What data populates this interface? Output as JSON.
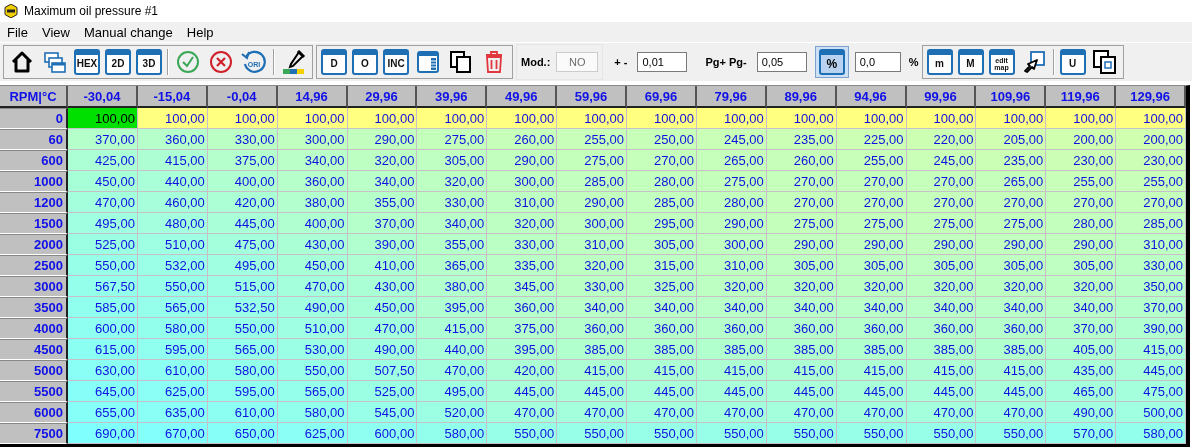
{
  "window": {
    "title": "Maximum oil pressure #1"
  },
  "menu": [
    {
      "label": "File"
    },
    {
      "label": "View"
    },
    {
      "label": "Manual change"
    },
    {
      "label": "Help"
    }
  ],
  "toolbar": {
    "groups": [
      [
        {
          "kind": "home"
        },
        {
          "kind": "windows"
        },
        {
          "kind": "tile",
          "label": "HEX"
        },
        {
          "kind": "tile",
          "label": "2D"
        },
        {
          "kind": "tile",
          "label": "3D"
        },
        {
          "kind": "sep"
        },
        {
          "kind": "accept"
        },
        {
          "kind": "cancel"
        },
        {
          "kind": "revert",
          "label": "ORI"
        },
        {
          "kind": "sep"
        },
        {
          "kind": "picker"
        }
      ],
      [
        {
          "kind": "tile",
          "label": "D"
        },
        {
          "kind": "tile",
          "label": "O"
        },
        {
          "kind": "tile",
          "label": "INC"
        },
        {
          "kind": "panel"
        },
        {
          "kind": "copy"
        },
        {
          "kind": "trash"
        }
      ]
    ],
    "mod": {
      "label": "Mod.:",
      "value": "NO",
      "disabled": true
    },
    "step": {
      "label": "+ -",
      "value": "0,01"
    },
    "page_step": {
      "label": "Pg+ Pg-",
      "value": "0,05"
    },
    "percent": {
      "label": "%",
      "on": true,
      "value": "0,0",
      "unit": "%"
    },
    "groups_right": [
      [
        {
          "kind": "tile",
          "label": "m"
        },
        {
          "kind": "tile",
          "label": "M"
        },
        {
          "kind": "small_tile",
          "label": "edit map"
        },
        {
          "kind": "cursor"
        },
        {
          "kind": "sep"
        },
        {
          "kind": "tile",
          "label": "U"
        },
        {
          "kind": "frames"
        }
      ]
    ]
  },
  "table": {
    "corner": "RPM|°C",
    "columns": [
      "-30,04",
      "-15,04",
      "-0,04",
      "14,96",
      "29,96",
      "39,96",
      "49,96",
      "59,96",
      "69,96",
      "79,96",
      "89,96",
      "94,96",
      "99,96",
      "109,96",
      "119,96",
      "129,96"
    ],
    "rows": [
      {
        "label": "0",
        "cells": [
          {
            "value": "100,00",
            "selected": true
          },
          {
            "value": "100,00",
            "selected": false
          },
          {
            "value": "100,00",
            "selected": false
          },
          {
            "value": "100,00",
            "selected": false
          },
          {
            "value": "100,00",
            "selected": false
          },
          {
            "value": "100,00",
            "selected": false
          },
          {
            "value": "100,00",
            "selected": false
          },
          {
            "value": "100,00",
            "selected": false
          },
          {
            "value": "100,00",
            "selected": false
          },
          {
            "value": "100,00",
            "selected": false
          },
          {
            "value": "100,00",
            "selected": false
          },
          {
            "value": "100,00",
            "selected": false
          },
          {
            "value": "100,00",
            "selected": false
          },
          {
            "value": "100,00",
            "selected": false
          },
          {
            "value": "100,00",
            "selected": false
          },
          {
            "value": "100,00",
            "selected": false
          }
        ]
      },
      {
        "label": "60",
        "cells": [
          {
            "value": "370,00",
            "selected": false
          },
          {
            "value": "360,00",
            "selected": false
          },
          {
            "value": "330,00",
            "selected": false
          },
          {
            "value": "300,00",
            "selected": false
          },
          {
            "value": "290,00",
            "selected": false
          },
          {
            "value": "275,00",
            "selected": false
          },
          {
            "value": "260,00",
            "selected": false
          },
          {
            "value": "255,00",
            "selected": false
          },
          {
            "value": "250,00",
            "selected": false
          },
          {
            "value": "245,00",
            "selected": false
          },
          {
            "value": "235,00",
            "selected": false
          },
          {
            "value": "225,00",
            "selected": false
          },
          {
            "value": "220,00",
            "selected": false
          },
          {
            "value": "205,00",
            "selected": false
          },
          {
            "value": "200,00",
            "selected": false
          },
          {
            "value": "200,00",
            "selected": false
          }
        ]
      },
      {
        "label": "600",
        "cells": [
          {
            "value": "425,00",
            "selected": false
          },
          {
            "value": "415,00",
            "selected": false
          },
          {
            "value": "375,00",
            "selected": false
          },
          {
            "value": "340,00",
            "selected": false
          },
          {
            "value": "320,00",
            "selected": false
          },
          {
            "value": "305,00",
            "selected": false
          },
          {
            "value": "290,00",
            "selected": false
          },
          {
            "value": "275,00",
            "selected": false
          },
          {
            "value": "270,00",
            "selected": false
          },
          {
            "value": "265,00",
            "selected": false
          },
          {
            "value": "260,00",
            "selected": false
          },
          {
            "value": "255,00",
            "selected": false
          },
          {
            "value": "245,00",
            "selected": false
          },
          {
            "value": "235,00",
            "selected": false
          },
          {
            "value": "230,00",
            "selected": false
          },
          {
            "value": "230,00",
            "selected": false
          }
        ]
      },
      {
        "label": "1000",
        "cells": [
          {
            "value": "450,00",
            "selected": false
          },
          {
            "value": "440,00",
            "selected": false
          },
          {
            "value": "400,00",
            "selected": false
          },
          {
            "value": "360,00",
            "selected": false
          },
          {
            "value": "340,00",
            "selected": false
          },
          {
            "value": "320,00",
            "selected": false
          },
          {
            "value": "300,00",
            "selected": false
          },
          {
            "value": "285,00",
            "selected": false
          },
          {
            "value": "280,00",
            "selected": false
          },
          {
            "value": "275,00",
            "selected": false
          },
          {
            "value": "270,00",
            "selected": false
          },
          {
            "value": "270,00",
            "selected": false
          },
          {
            "value": "270,00",
            "selected": false
          },
          {
            "value": "265,00",
            "selected": false
          },
          {
            "value": "255,00",
            "selected": false
          },
          {
            "value": "255,00",
            "selected": false
          }
        ]
      },
      {
        "label": "1200",
        "cells": [
          {
            "value": "470,00",
            "selected": false
          },
          {
            "value": "460,00",
            "selected": false
          },
          {
            "value": "420,00",
            "selected": false
          },
          {
            "value": "380,00",
            "selected": false
          },
          {
            "value": "355,00",
            "selected": false
          },
          {
            "value": "330,00",
            "selected": false
          },
          {
            "value": "310,00",
            "selected": false
          },
          {
            "value": "290,00",
            "selected": false
          },
          {
            "value": "285,00",
            "selected": false
          },
          {
            "value": "280,00",
            "selected": false
          },
          {
            "value": "270,00",
            "selected": false
          },
          {
            "value": "270,00",
            "selected": false
          },
          {
            "value": "270,00",
            "selected": false
          },
          {
            "value": "270,00",
            "selected": false
          },
          {
            "value": "270,00",
            "selected": false
          },
          {
            "value": "270,00",
            "selected": false
          }
        ]
      },
      {
        "label": "1500",
        "cells": [
          {
            "value": "495,00",
            "selected": false
          },
          {
            "value": "480,00",
            "selected": false
          },
          {
            "value": "445,00",
            "selected": false
          },
          {
            "value": "400,00",
            "selected": false
          },
          {
            "value": "370,00",
            "selected": false
          },
          {
            "value": "340,00",
            "selected": false
          },
          {
            "value": "320,00",
            "selected": false
          },
          {
            "value": "300,00",
            "selected": false
          },
          {
            "value": "295,00",
            "selected": false
          },
          {
            "value": "290,00",
            "selected": false
          },
          {
            "value": "275,00",
            "selected": false
          },
          {
            "value": "275,00",
            "selected": false
          },
          {
            "value": "275,00",
            "selected": false
          },
          {
            "value": "275,00",
            "selected": false
          },
          {
            "value": "280,00",
            "selected": false
          },
          {
            "value": "285,00",
            "selected": false
          }
        ]
      },
      {
        "label": "2000",
        "cells": [
          {
            "value": "525,00",
            "selected": false
          },
          {
            "value": "510,00",
            "selected": false
          },
          {
            "value": "475,00",
            "selected": false
          },
          {
            "value": "430,00",
            "selected": false
          },
          {
            "value": "390,00",
            "selected": false
          },
          {
            "value": "355,00",
            "selected": false
          },
          {
            "value": "330,00",
            "selected": false
          },
          {
            "value": "310,00",
            "selected": false
          },
          {
            "value": "305,00",
            "selected": false
          },
          {
            "value": "300,00",
            "selected": false
          },
          {
            "value": "290,00",
            "selected": false
          },
          {
            "value": "290,00",
            "selected": false
          },
          {
            "value": "290,00",
            "selected": false
          },
          {
            "value": "290,00",
            "selected": false
          },
          {
            "value": "290,00",
            "selected": false
          },
          {
            "value": "310,00",
            "selected": false
          }
        ]
      },
      {
        "label": "2500",
        "cells": [
          {
            "value": "550,00",
            "selected": false
          },
          {
            "value": "532,00",
            "selected": false
          },
          {
            "value": "495,00",
            "selected": false
          },
          {
            "value": "450,00",
            "selected": false
          },
          {
            "value": "410,00",
            "selected": false
          },
          {
            "value": "365,00",
            "selected": false
          },
          {
            "value": "335,00",
            "selected": false
          },
          {
            "value": "320,00",
            "selected": false
          },
          {
            "value": "315,00",
            "selected": false
          },
          {
            "value": "310,00",
            "selected": false
          },
          {
            "value": "305,00",
            "selected": false
          },
          {
            "value": "305,00",
            "selected": false
          },
          {
            "value": "305,00",
            "selected": false
          },
          {
            "value": "305,00",
            "selected": false
          },
          {
            "value": "305,00",
            "selected": false
          },
          {
            "value": "330,00",
            "selected": false
          }
        ]
      },
      {
        "label": "3000",
        "cells": [
          {
            "value": "567,50",
            "selected": false
          },
          {
            "value": "550,00",
            "selected": false
          },
          {
            "value": "515,00",
            "selected": false
          },
          {
            "value": "470,00",
            "selected": false
          },
          {
            "value": "430,00",
            "selected": false
          },
          {
            "value": "380,00",
            "selected": false
          },
          {
            "value": "345,00",
            "selected": false
          },
          {
            "value": "330,00",
            "selected": false
          },
          {
            "value": "325,00",
            "selected": false
          },
          {
            "value": "320,00",
            "selected": false
          },
          {
            "value": "320,00",
            "selected": false
          },
          {
            "value": "320,00",
            "selected": false
          },
          {
            "value": "320,00",
            "selected": false
          },
          {
            "value": "320,00",
            "selected": false
          },
          {
            "value": "320,00",
            "selected": false
          },
          {
            "value": "350,00",
            "selected": false
          }
        ]
      },
      {
        "label": "3500",
        "cells": [
          {
            "value": "585,00",
            "selected": false
          },
          {
            "value": "565,00",
            "selected": false
          },
          {
            "value": "532,50",
            "selected": false
          },
          {
            "value": "490,00",
            "selected": false
          },
          {
            "value": "450,00",
            "selected": false
          },
          {
            "value": "395,00",
            "selected": false
          },
          {
            "value": "360,00",
            "selected": false
          },
          {
            "value": "340,00",
            "selected": false
          },
          {
            "value": "340,00",
            "selected": false
          },
          {
            "value": "340,00",
            "selected": false
          },
          {
            "value": "340,00",
            "selected": false
          },
          {
            "value": "340,00",
            "selected": false
          },
          {
            "value": "340,00",
            "selected": false
          },
          {
            "value": "340,00",
            "selected": false
          },
          {
            "value": "340,00",
            "selected": false
          },
          {
            "value": "370,00",
            "selected": false
          }
        ]
      },
      {
        "label": "4000",
        "cells": [
          {
            "value": "600,00",
            "selected": false
          },
          {
            "value": "580,00",
            "selected": false
          },
          {
            "value": "550,00",
            "selected": false
          },
          {
            "value": "510,00",
            "selected": false
          },
          {
            "value": "470,00",
            "selected": false
          },
          {
            "value": "415,00",
            "selected": false
          },
          {
            "value": "375,00",
            "selected": false
          },
          {
            "value": "360,00",
            "selected": false
          },
          {
            "value": "360,00",
            "selected": false
          },
          {
            "value": "360,00",
            "selected": false
          },
          {
            "value": "360,00",
            "selected": false
          },
          {
            "value": "360,00",
            "selected": false
          },
          {
            "value": "360,00",
            "selected": false
          },
          {
            "value": "360,00",
            "selected": false
          },
          {
            "value": "370,00",
            "selected": false
          },
          {
            "value": "390,00",
            "selected": false
          }
        ]
      },
      {
        "label": "4500",
        "cells": [
          {
            "value": "615,00",
            "selected": false
          },
          {
            "value": "595,00",
            "selected": false
          },
          {
            "value": "565,00",
            "selected": false
          },
          {
            "value": "530,00",
            "selected": false
          },
          {
            "value": "490,00",
            "selected": false
          },
          {
            "value": "440,00",
            "selected": false
          },
          {
            "value": "395,00",
            "selected": false
          },
          {
            "value": "385,00",
            "selected": false
          },
          {
            "value": "385,00",
            "selected": false
          },
          {
            "value": "385,00",
            "selected": false
          },
          {
            "value": "385,00",
            "selected": false
          },
          {
            "value": "385,00",
            "selected": false
          },
          {
            "value": "385,00",
            "selected": false
          },
          {
            "value": "385,00",
            "selected": false
          },
          {
            "value": "405,00",
            "selected": false
          },
          {
            "value": "415,00",
            "selected": false
          }
        ]
      },
      {
        "label": "5000",
        "cells": [
          {
            "value": "630,00",
            "selected": false
          },
          {
            "value": "610,00",
            "selected": false
          },
          {
            "value": "580,00",
            "selected": false
          },
          {
            "value": "550,00",
            "selected": false
          },
          {
            "value": "507,50",
            "selected": false
          },
          {
            "value": "470,00",
            "selected": false
          },
          {
            "value": "420,00",
            "selected": false
          },
          {
            "value": "415,00",
            "selected": false
          },
          {
            "value": "415,00",
            "selected": false
          },
          {
            "value": "415,00",
            "selected": false
          },
          {
            "value": "415,00",
            "selected": false
          },
          {
            "value": "415,00",
            "selected": false
          },
          {
            "value": "415,00",
            "selected": false
          },
          {
            "value": "415,00",
            "selected": false
          },
          {
            "value": "435,00",
            "selected": false
          },
          {
            "value": "445,00",
            "selected": false
          }
        ]
      },
      {
        "label": "5500",
        "cells": [
          {
            "value": "645,00",
            "selected": false
          },
          {
            "value": "625,00",
            "selected": false
          },
          {
            "value": "595,00",
            "selected": false
          },
          {
            "value": "565,00",
            "selected": false
          },
          {
            "value": "525,00",
            "selected": false
          },
          {
            "value": "495,00",
            "selected": false
          },
          {
            "value": "445,00",
            "selected": false
          },
          {
            "value": "445,00",
            "selected": false
          },
          {
            "value": "445,00",
            "selected": false
          },
          {
            "value": "445,00",
            "selected": false
          },
          {
            "value": "445,00",
            "selected": false
          },
          {
            "value": "445,00",
            "selected": false
          },
          {
            "value": "445,00",
            "selected": false
          },
          {
            "value": "445,00",
            "selected": false
          },
          {
            "value": "465,00",
            "selected": false
          },
          {
            "value": "475,00",
            "selected": false
          }
        ]
      },
      {
        "label": "6000",
        "cells": [
          {
            "value": "655,00",
            "selected": false
          },
          {
            "value": "635,00",
            "selected": false
          },
          {
            "value": "610,00",
            "selected": false
          },
          {
            "value": "580,00",
            "selected": false
          },
          {
            "value": "545,00",
            "selected": false
          },
          {
            "value": "520,00",
            "selected": false
          },
          {
            "value": "470,00",
            "selected": false
          },
          {
            "value": "470,00",
            "selected": false
          },
          {
            "value": "470,00",
            "selected": false
          },
          {
            "value": "470,00",
            "selected": false
          },
          {
            "value": "470,00",
            "selected": false
          },
          {
            "value": "470,00",
            "selected": false
          },
          {
            "value": "470,00",
            "selected": false
          },
          {
            "value": "470,00",
            "selected": false
          },
          {
            "value": "490,00",
            "selected": false
          },
          {
            "value": "500,00",
            "selected": false
          }
        ]
      },
      {
        "label": "7500",
        "cells": [
          {
            "value": "690,00",
            "selected": false
          },
          {
            "value": "670,00",
            "selected": false
          },
          {
            "value": "650,00",
            "selected": false
          },
          {
            "value": "625,00",
            "selected": false
          },
          {
            "value": "600,00",
            "selected": false
          },
          {
            "value": "580,00",
            "selected": false
          },
          {
            "value": "550,00",
            "selected": false
          },
          {
            "value": "550,00",
            "selected": false
          },
          {
            "value": "550,00",
            "selected": false
          },
          {
            "value": "550,00",
            "selected": false
          },
          {
            "value": "550,00",
            "selected": false
          },
          {
            "value": "550,00",
            "selected": false
          },
          {
            "value": "550,00",
            "selected": false
          },
          {
            "value": "550,00",
            "selected": false
          },
          {
            "value": "570,00",
            "selected": false
          },
          {
            "value": "580,00",
            "selected": false
          }
        ]
      }
    ]
  }
}
